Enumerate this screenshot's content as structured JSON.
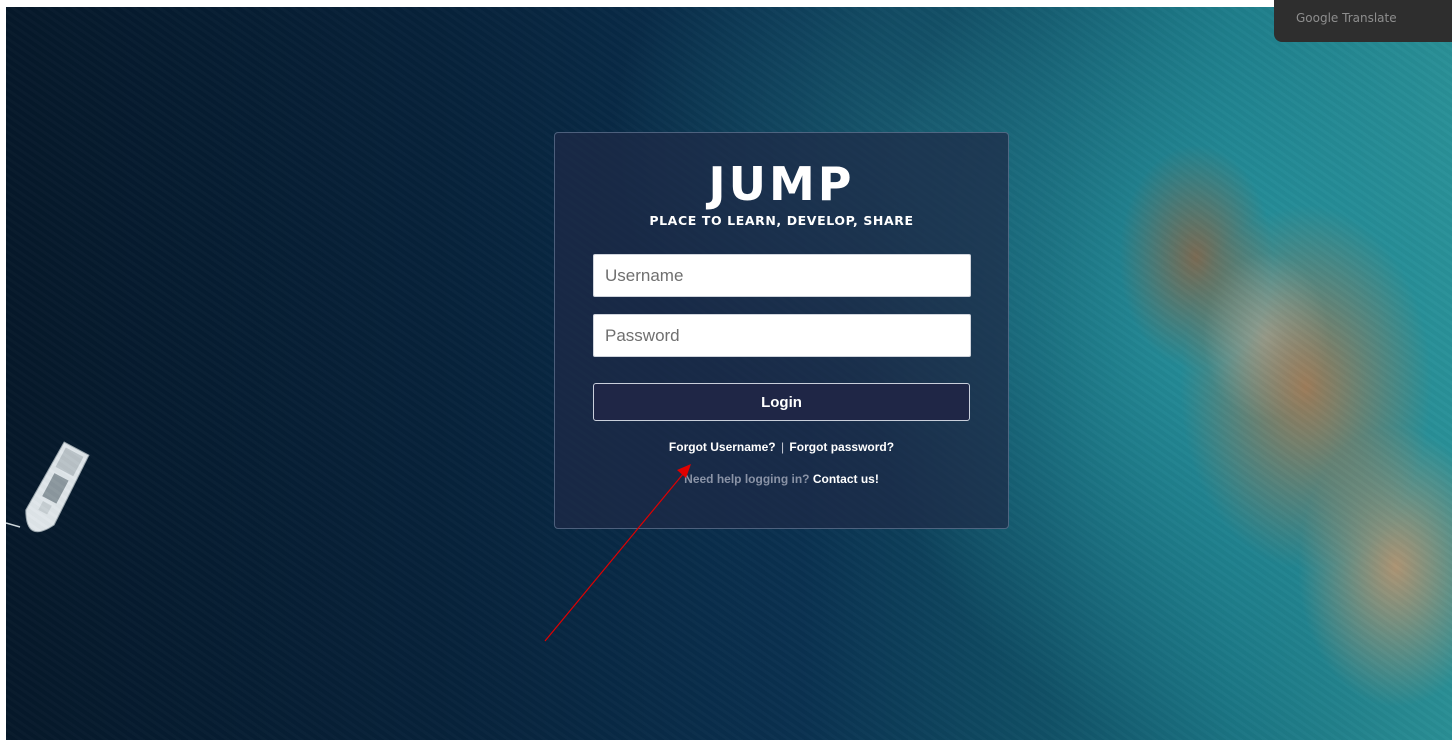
{
  "translate_tab": {
    "label": "Google Translate"
  },
  "logo": {
    "text": "JUMP"
  },
  "tagline": "PLACE TO LEARN, DEVELOP, SHARE",
  "form": {
    "username_placeholder": "Username",
    "password_placeholder": "Password",
    "login_label": "Login"
  },
  "links": {
    "forgot_username": "Forgot Username?",
    "separator": "|",
    "forgot_password": "Forgot password?",
    "help_text": "Need help logging in?",
    "contact": "Contact us!"
  },
  "colors": {
    "panel": "#1e2a46",
    "button": "#1f2646",
    "annotation_arrow": "#e00000"
  }
}
